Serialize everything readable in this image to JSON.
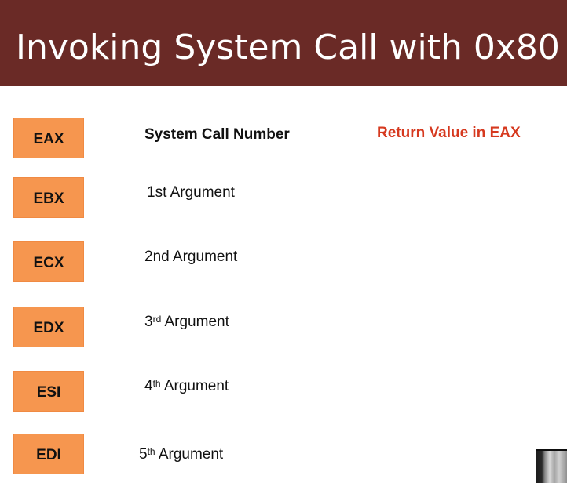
{
  "title": "Invoking System Call with 0x80",
  "return_note": "Return Value in EAX",
  "registers": [
    {
      "name": "EAX",
      "desc_base": "System Call Number",
      "desc_sup": "",
      "desc_tail": ""
    },
    {
      "name": "EBX",
      "desc_base": "1st Argument",
      "desc_sup": "",
      "desc_tail": ""
    },
    {
      "name": "ECX",
      "desc_base": "2nd Argument",
      "desc_sup": "",
      "desc_tail": ""
    },
    {
      "name": "EDX",
      "desc_base": "3",
      "desc_sup": "rd",
      "desc_tail": " Argument"
    },
    {
      "name": "ESI",
      "desc_base": "4",
      "desc_sup": "th",
      "desc_tail": " Argument"
    },
    {
      "name": "EDI",
      "desc_base": "5",
      "desc_sup": "th",
      "desc_tail": " Argument"
    }
  ],
  "colors": {
    "title_bar": "#6a2a26",
    "register_box": "#f6964f",
    "return_note": "#d6391f"
  }
}
